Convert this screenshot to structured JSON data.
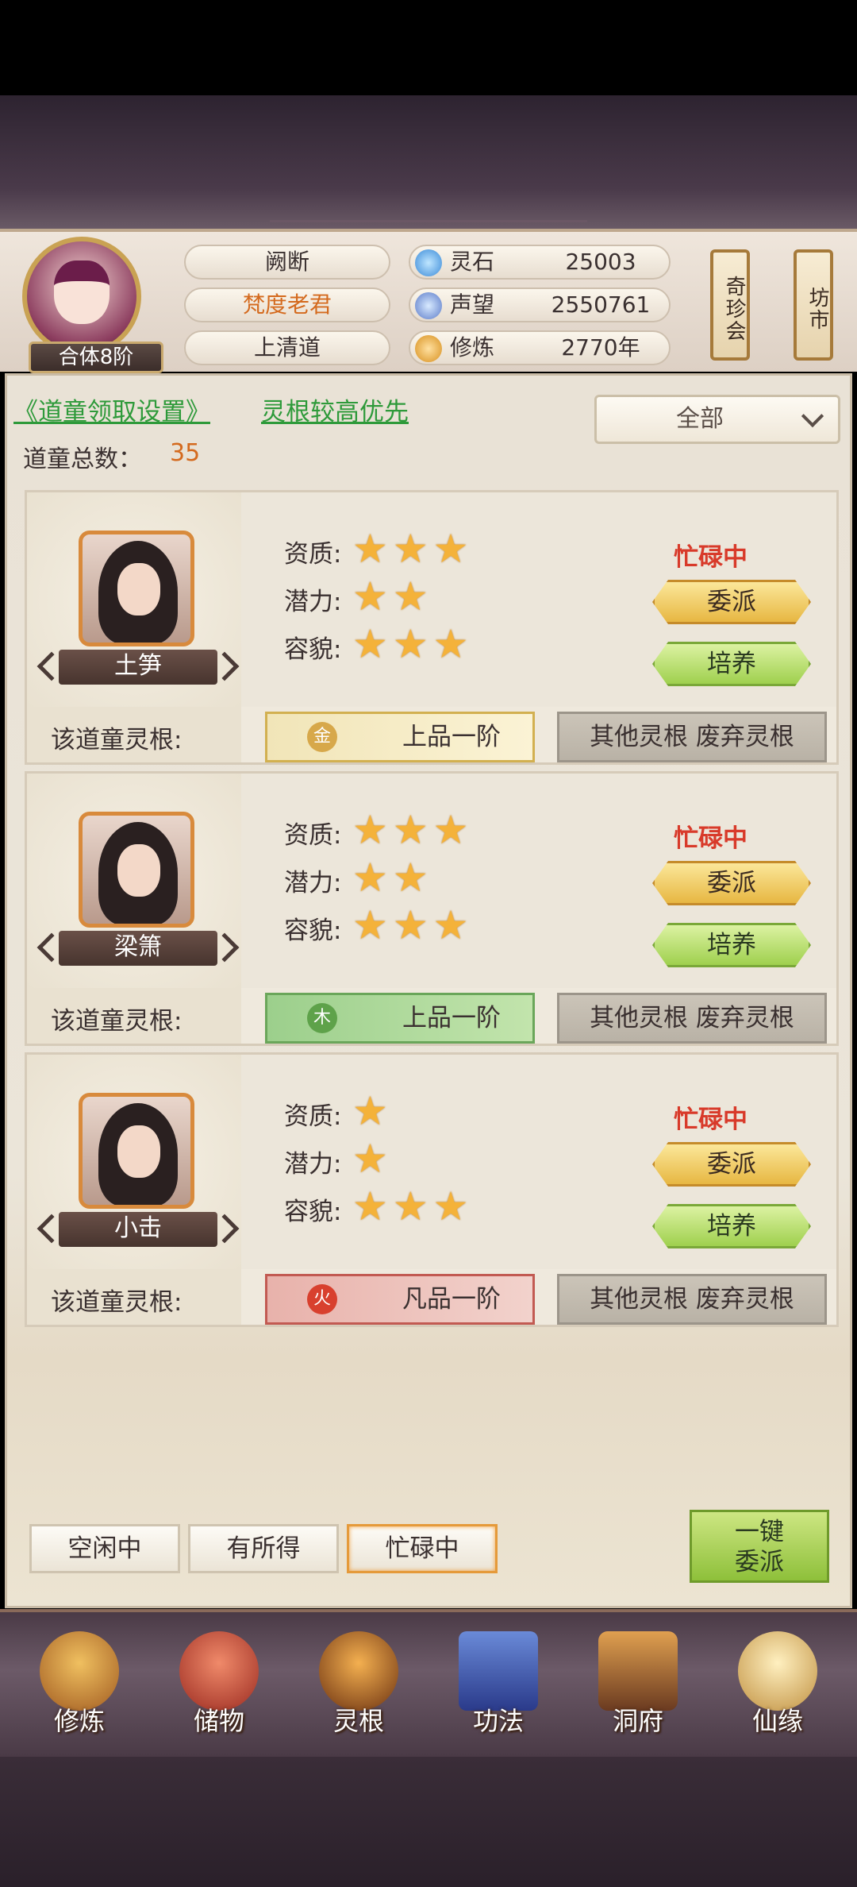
{
  "header": {
    "rank": "合体8阶",
    "info": [
      "阙断",
      "梵度老君",
      "上清道"
    ],
    "resources": [
      {
        "label": "灵石",
        "value": "25003",
        "icon": "spirit-stone-icon"
      },
      {
        "label": "声望",
        "value": "2550761",
        "icon": "reputation-icon"
      },
      {
        "label": "修炼",
        "value": "2770年",
        "icon": "cultivation-icon"
      }
    ],
    "lanterns": [
      "奇珍会",
      "坊市"
    ]
  },
  "toolbar": {
    "settings_link": "《道童领取设置》",
    "priority_link": "灵根较高优先",
    "filter_value": "全部",
    "total_label": "道童总数：",
    "total_value": "35"
  },
  "labels": {
    "aptitude": "资质:",
    "potential": "潜力:",
    "looks": "容貌:",
    "root_label": "该道童灵根:",
    "assign": "委派",
    "train": "培养",
    "other_root": "其他灵根 废弃灵根"
  },
  "children": [
    {
      "name": "土笋",
      "status": "忙碌中",
      "aptitude": 3,
      "potential": 2,
      "looks": 3,
      "root_element": "金",
      "root_grade": "上品一阶",
      "root_type": "gold"
    },
    {
      "name": "梁箫",
      "status": "忙碌中",
      "aptitude": 3,
      "potential": 2,
      "looks": 3,
      "root_element": "木",
      "root_grade": "上品一阶",
      "root_type": "wood"
    },
    {
      "name": "小击",
      "status": "忙碌中",
      "aptitude": 1,
      "potential": 1,
      "looks": 3,
      "root_element": "火",
      "root_grade": "凡品一阶",
      "root_type": "fire"
    }
  ],
  "tabs": [
    "空闲中",
    "有所得",
    "忙碌中"
  ],
  "active_tab": 2,
  "one_key": "一键\n委派",
  "one_key_lines": [
    "一键",
    "委派"
  ],
  "nav": [
    "修炼",
    "储物",
    "灵根",
    "功法",
    "洞府",
    "仙缘"
  ],
  "colors": {
    "status": "#d83a2a",
    "link": "#2e9a3a",
    "accent": "#d46a1e"
  }
}
